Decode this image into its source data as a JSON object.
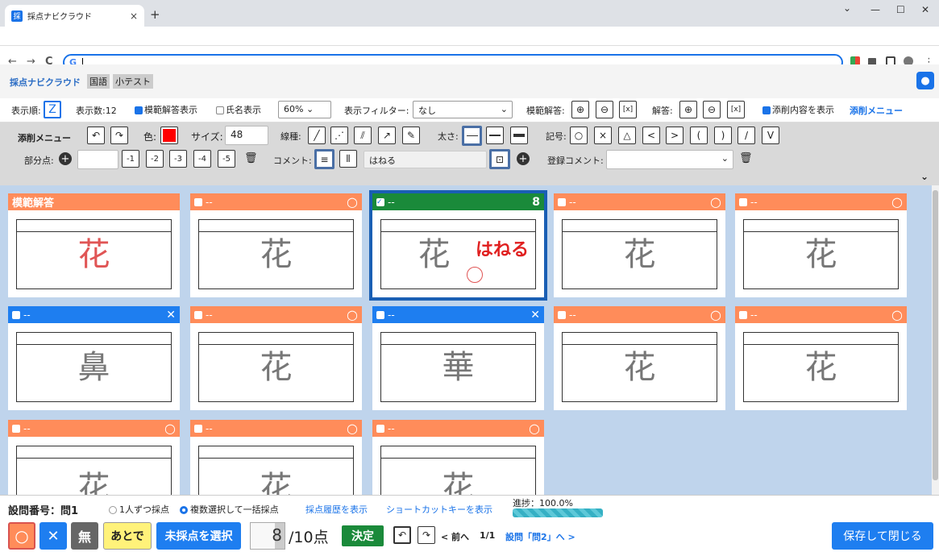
{
  "browser": {
    "tab_title": "採点ナビクラウド",
    "tab_icon": "採",
    "close_tab": "×",
    "new_tab": "+",
    "win_minimize": "—",
    "win_maximize": "☐",
    "win_close": "✕",
    "chevron": "⌄",
    "back": "←",
    "forward": "→",
    "reload": "C",
    "address_value": "",
    "g_icon": "G",
    "menu_dots": "⋮"
  },
  "app": {
    "title": "採点ナビクラウド",
    "subject": "国語",
    "test": "小テスト",
    "user_icon": "●"
  },
  "toolbar": {
    "order_label": "表示順:",
    "count_label": "表示数:12",
    "show_model_label": "模範解答表示",
    "show_name_label": "氏名表示",
    "zoom_value": "60%",
    "filter_label": "表示フィルター:",
    "filter_value": "なし",
    "model_answer_label": "模範解答:",
    "answer_label": "解答:",
    "show_correction_label": "添削内容を表示",
    "correction_menu_link": "添削メニュー",
    "zoom_in": "⊕",
    "zoom_out": "⊖",
    "fit": "[x]"
  },
  "correction": {
    "menu_label": "添削メニュー",
    "undo": "↶",
    "redo": "↷",
    "color_label": "色:",
    "color_value": "#ff0000",
    "size_label": "サイズ:",
    "size_value": "48",
    "line_type_label": "線種:",
    "thickness_label": "太さ:",
    "symbol_label": "記号:",
    "symbols": [
      "○",
      "×",
      "△",
      "<",
      ">",
      "(",
      ")",
      "/",
      "V"
    ],
    "partial_label": "部分点:",
    "partial_plus": "+",
    "partial_value": "",
    "partial_buttons": [
      "-1",
      "-2",
      "-3",
      "-4",
      "-5"
    ],
    "comment_label": "コメント:",
    "comment_value": "はねる",
    "registered_comment_label": "登録コメント:",
    "registered_comment_value": "",
    "collapse": "⌄",
    "trash": "🗑",
    "stamp": "⊡"
  },
  "cards": [
    {
      "label": "模範解答",
      "mark": "",
      "kanji": "花",
      "color": "#ff8c5a",
      "kanji_color": "#e05555"
    },
    {
      "label": "--",
      "mark": "○",
      "kanji": "花",
      "color": "#ff8c5a"
    },
    {
      "label": "--",
      "mark": "8",
      "kanji": "花",
      "color": "#1a8a3a",
      "comment": "はねる",
      "selected": true
    },
    {
      "label": "--",
      "mark": "○",
      "kanji": "花",
      "color": "#ff8c5a"
    },
    {
      "label": "--",
      "mark": "○",
      "kanji": "花",
      "color": "#ff8c5a"
    },
    {
      "label": "--",
      "mark": "✕",
      "kanji": "鼻",
      "color": "#1e7ef0"
    },
    {
      "label": "--",
      "mark": "○",
      "kanji": "花",
      "color": "#ff8c5a"
    },
    {
      "label": "--",
      "mark": "✕",
      "kanji": "華",
      "color": "#1e7ef0"
    },
    {
      "label": "--",
      "mark": "○",
      "kanji": "花",
      "color": "#ff8c5a"
    },
    {
      "label": "--",
      "mark": "○",
      "kanji": "花",
      "color": "#ff8c5a"
    },
    {
      "label": "--",
      "mark": "○",
      "kanji": "花",
      "color": "#ff8c5a"
    },
    {
      "label": "--",
      "mark": "○",
      "kanji": "花",
      "color": "#ff8c5a"
    },
    {
      "label": "--",
      "mark": "○",
      "kanji": "花",
      "color": "#ff8c5a"
    }
  ],
  "bottom": {
    "question_label": "設問番号：問1",
    "mode_single": "1人ずつ採点",
    "mode_multi": "複数選択して一括採点",
    "history_link": "採点履歴を表示",
    "shortcut_link": "ショートカットキーを表示",
    "progress_label": "進捗：100.0%",
    "progress": 1.0,
    "btn_correct": "○",
    "btn_wrong": "✕",
    "btn_none": "無",
    "btn_later": "あとで",
    "btn_select_ungraded": "未採点を選択",
    "score_value": "8",
    "score_total": "/10点",
    "btn_decide": "決定",
    "undo": "↶",
    "redo": "↷",
    "prev": "< 前へ",
    "page": "1/1",
    "next_question": "設問「問2」へ >",
    "save_close": "保存して閉じる"
  }
}
